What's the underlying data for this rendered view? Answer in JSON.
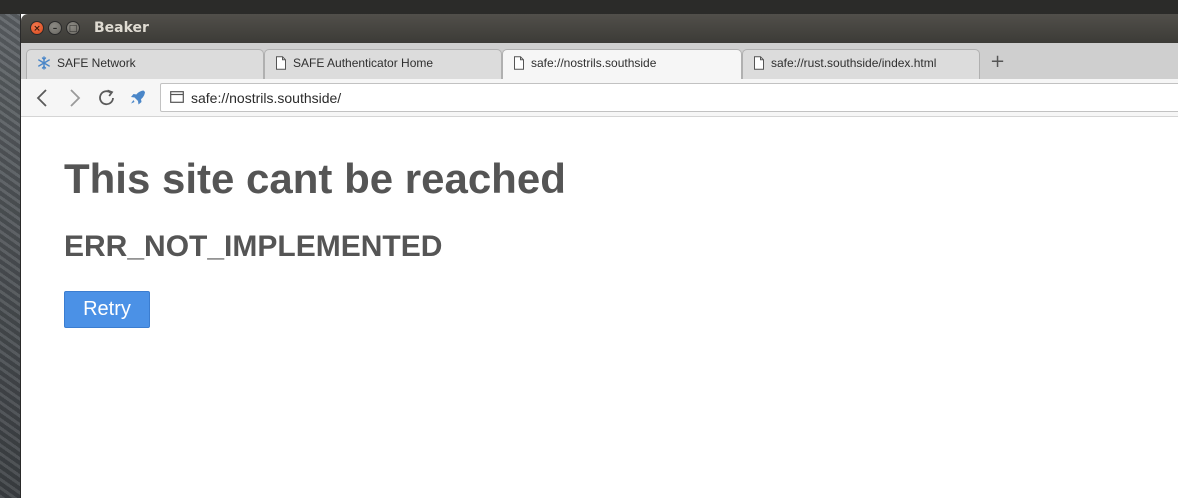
{
  "window": {
    "title": "Beaker",
    "controls": {
      "close": "×",
      "minimize": "–",
      "maximize": "□"
    }
  },
  "tabs": [
    {
      "label": "SAFE Network",
      "icon": "snowflake-icon",
      "active": false
    },
    {
      "label": "SAFE Authenticator Home",
      "icon": "page-icon",
      "active": false
    },
    {
      "label": "safe://nostrils.southside",
      "icon": "page-icon",
      "active": true
    },
    {
      "label": "safe://rust.southside/index.html",
      "icon": "page-icon",
      "active": false
    }
  ],
  "new_tab_label": "+",
  "toolbar": {
    "back_icon": "chevron-left-icon",
    "forward_icon": "chevron-right-icon",
    "reload_icon": "reload-icon",
    "rocket_icon": "rocket-icon",
    "url": "safe://nostrils.southside/"
  },
  "page": {
    "title": "This site cant be reached",
    "error_code": "ERR_NOT_IMPLEMENTED",
    "retry_label": "Retry"
  },
  "colors": {
    "accent": "#4b91e6",
    "heading": "#555555",
    "titlebar": "#3c3b37",
    "close_button": "#e05a2b"
  }
}
